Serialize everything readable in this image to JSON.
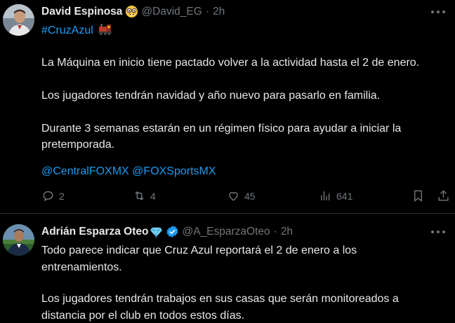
{
  "tweets": [
    {
      "author_name": "David Espinosa",
      "author_handle": "@David_EG",
      "separator": "·",
      "time": "2h",
      "name_emoji_icon": "nerd-face-emoji-icon",
      "hashtag": "#CruzAzul",
      "hashtag_emoji_icon": "locomotive-emoji-icon",
      "paragraphs": [
        "La Máquina en inicio tiene pactado volver a la actividad hasta el 2 de enero.",
        "Los jugadores tendrán navidad y año nuevo para pasarlo en familia.",
        "Durante 3 semanas estarán en un régimen físico para ayudar a iniciar la",
        "pretemporada."
      ],
      "mentions": [
        "@CentralFOXMX",
        "@FOXSportsMX"
      ],
      "actions": {
        "replies": "2",
        "retweets": "4",
        "likes": "45",
        "views": "641"
      }
    },
    {
      "author_name": "Adrián Esparza Oteo",
      "author_handle": "@A_EsparzaOteo",
      "separator": "·",
      "time": "2h",
      "name_emoji_icon": "gem-emoji-icon",
      "verified_icon": "verified-badge-icon",
      "lines": [
        "Todo parece indicar que Cruz Azul reportará el 2 de enero a los",
        "entrenamientos.",
        "Los jugadores tendrán trabajos en sus casas que serán monitoreados a",
        "distancia por el club en todos estos días."
      ]
    }
  ],
  "colors": {
    "background": "#000000",
    "text": "#e7e9ea",
    "secondary": "#71767b",
    "link": "#1d9bf0",
    "divider": "#2f3336"
  }
}
